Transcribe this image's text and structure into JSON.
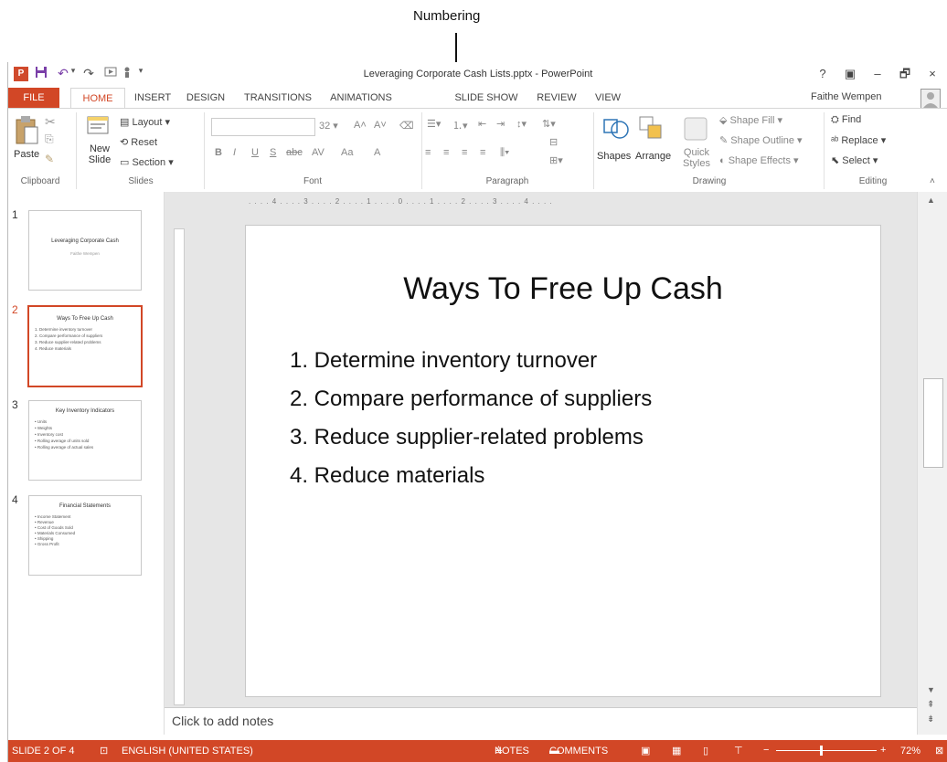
{
  "callout": "Numbering",
  "window": {
    "title": "Leveraging Corporate Cash Lists.pptx - PowerPoint",
    "help": "?",
    "controls": [
      "▣",
      "–",
      "🗗",
      "×"
    ]
  },
  "qat": {
    "app_icon": "P",
    "save_icon": "save-icon",
    "undo": "↶",
    "redo": "↷",
    "more": "▾"
  },
  "tabs": [
    "FILE",
    "HOME",
    "INSERT",
    "DESIGN",
    "TRANSITIONS",
    "ANIMATIONS",
    "SLIDE SHOW",
    "REVIEW",
    "VIEW"
  ],
  "user": "Faithe Wempen",
  "ribbon": {
    "clipboard": {
      "paste": "Paste",
      "label": "Clipboard"
    },
    "slides": {
      "new_slide": "New\nSlide",
      "layout": "Layout",
      "reset": "Reset",
      "section": "Section",
      "label": "Slides"
    },
    "font": {
      "size": "32",
      "label": "Font",
      "buttons": [
        "B",
        "I",
        "U",
        "S",
        "abc",
        "AV",
        "Aa",
        "A"
      ]
    },
    "paragraph": {
      "label": "Paragraph"
    },
    "drawing": {
      "shapes": "Shapes",
      "arrange": "Arrange",
      "quick_styles": "Quick\nStyles",
      "shape_fill": "Shape Fill",
      "shape_outline": "Shape Outline",
      "shape_effects": "Shape Effects",
      "label": "Drawing"
    },
    "editing": {
      "find": "Find",
      "replace": "Replace",
      "select": "Select",
      "label": "Editing"
    }
  },
  "ruler": ". . . . 4 . . . . 3 . . . . 2 . . . . 1 . . . . 0 . . . . 1 . . . . 2 . . . . 3 . . . . 4 . . . .",
  "thumbnails": [
    {
      "num": "1",
      "title": "Leveraging Corporate Cash",
      "lines": [
        "Faithe Wempen"
      ]
    },
    {
      "num": "2",
      "title": "Ways To Free Up Cash",
      "lines": [
        "1. Determine inventory turnover",
        "2. Compare performance of suppliers",
        "3. Reduce supplier-related problems",
        "4. Reduce materials"
      ]
    },
    {
      "num": "3",
      "title": "Key Inventory Indicators",
      "lines": [
        "• Units",
        "• Weights",
        "• Inventory cost",
        "• Rolling average of units sold",
        "• Rolling average of actual sales"
      ]
    },
    {
      "num": "4",
      "title": "Financial Statements",
      "lines": [
        "• Income Statement",
        "• Revenue",
        "• Cost of Goods Sold",
        "• Materials Consumed",
        "• Shipping",
        "• Gross Profit"
      ]
    }
  ],
  "slide": {
    "title": "Ways To Free Up Cash",
    "bullets": [
      "1.  Determine inventory turnover",
      "2.  Compare performance of suppliers",
      "3.  Reduce supplier-related problems",
      "4.  Reduce materials"
    ]
  },
  "notes_placeholder": "Click to add notes",
  "status": {
    "slide": "SLIDE 2 OF 4",
    "language": "ENGLISH (UNITED STATES)",
    "notes": "NOTES",
    "comments": "COMMENTS",
    "zoom": "72%"
  }
}
